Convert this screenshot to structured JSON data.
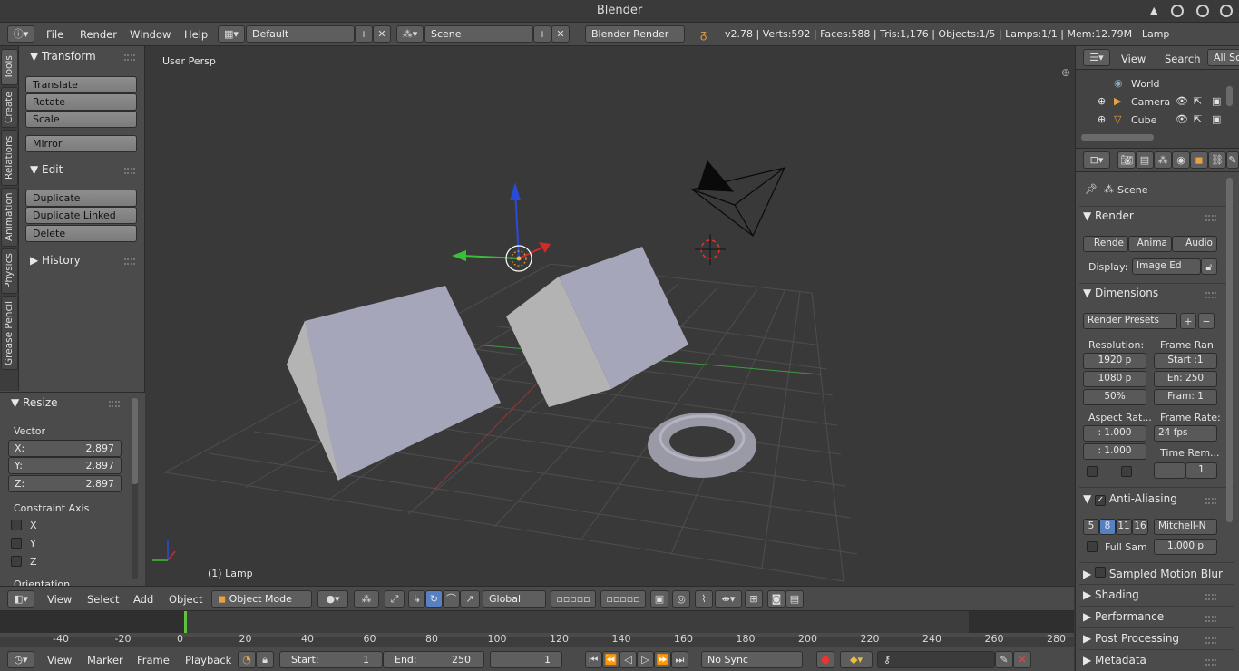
{
  "window": {
    "title": "Blender"
  },
  "topbar": {
    "menus": [
      "File",
      "Render",
      "Window",
      "Help"
    ],
    "screen_layout": "Default",
    "scene": "Scene",
    "engine": "Blender Render",
    "stats": "v2.78 | Verts:592 | Faces:588 | Tris:1,176 | Objects:1/5 | Lamps:1/1 | Mem:12.79M | Lamp"
  },
  "tool_tabs": [
    "Tools",
    "Create",
    "Relations",
    "Animation",
    "Physics",
    "Grease Pencil"
  ],
  "toolshelf": {
    "transform": {
      "title": "Transform",
      "buttons": [
        "Translate",
        "Rotate",
        "Scale",
        "Mirror"
      ]
    },
    "edit": {
      "title": "Edit",
      "buttons": [
        "Duplicate",
        "Duplicate Linked",
        "Delete"
      ]
    },
    "history": {
      "title": "History"
    }
  },
  "resize_panel": {
    "title": "Resize",
    "vector_label": "Vector",
    "x": {
      "label": "X:",
      "value": "2.897"
    },
    "y": {
      "label": "Y:",
      "value": "2.897"
    },
    "z": {
      "label": "Z:",
      "value": "2.897"
    },
    "constraint_label": "Constraint Axis",
    "axes": [
      "X",
      "Y",
      "Z"
    ],
    "orientation_label": "Orientation"
  },
  "viewport": {
    "view_name": "User Persp",
    "active_object": "(1) Lamp"
  },
  "viewport_header": {
    "menus": [
      "View",
      "Select",
      "Add",
      "Object"
    ],
    "mode": "Object Mode",
    "orientation": "Global"
  },
  "timeline": {
    "ticks": [
      "-40",
      "-20",
      "0",
      "20",
      "40",
      "60",
      "80",
      "100",
      "120",
      "140",
      "160",
      "180",
      "200",
      "220",
      "240",
      "260",
      "280"
    ],
    "current_frame": 0
  },
  "timeline_header": {
    "menus": [
      "View",
      "Marker",
      "Frame",
      "Playback"
    ],
    "start_label": "Start:",
    "start_value": "1",
    "end_label": "End:",
    "end_value": "250",
    "current": "1",
    "sync": "No Sync"
  },
  "outliner": {
    "menus": [
      "View",
      "Search"
    ],
    "filter": "All Sc",
    "items": [
      "World",
      "Camera",
      "Cube"
    ]
  },
  "properties": {
    "context": "Scene",
    "render": {
      "title": "Render",
      "buttons": [
        "Rende",
        "Anima",
        "Audio"
      ],
      "display_label": "Display:",
      "display_value": "Image Ed"
    },
    "dimensions": {
      "title": "Dimensions",
      "presets": "Render Presets",
      "resolution_label": "Resolution:",
      "res_x": "1920 p",
      "res_y": "1080 p",
      "res_pct": "50%",
      "frame_range_label": "Frame Ran",
      "start": "Start :1",
      "end": "En: 250",
      "step": "Fram: 1",
      "aspect_label": "Aspect Rat...",
      "aspect_x": ": 1.000",
      "aspect_y": ": 1.000",
      "frame_rate_label": "Frame Rate:",
      "fps": "24 fps",
      "time_remap_label": "Time Rem...",
      "time_remap": "1"
    },
    "anti_aliasing": {
      "title": "Anti-Aliasing",
      "samples": [
        "5",
        "8",
        "11",
        "16"
      ],
      "filter": "Mitchell-N",
      "full_sample": "Full Sam",
      "size": "1.000 p"
    },
    "collapsed": [
      "Sampled Motion Blur",
      "Shading",
      "Performance",
      "Post Processing",
      "Metadata"
    ]
  },
  "colors": {
    "accent": "#5680c2",
    "frame_marker": "#60c040"
  }
}
